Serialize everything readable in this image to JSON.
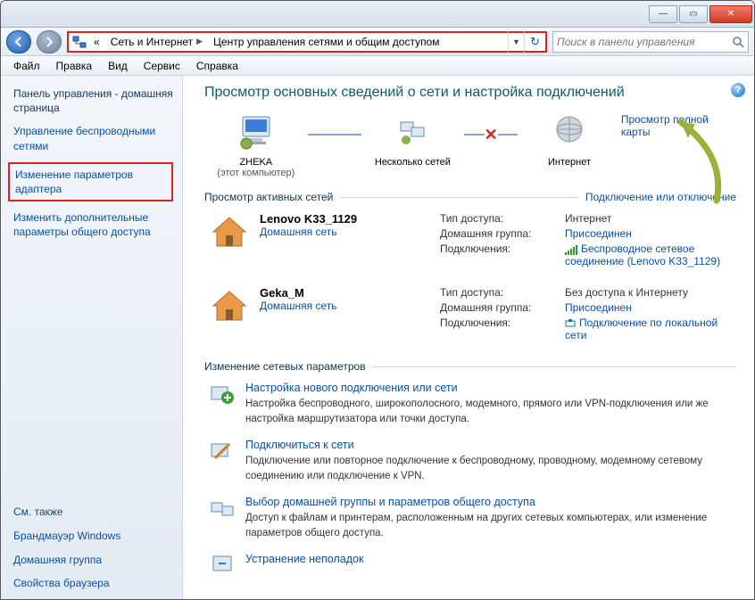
{
  "breadcrumb": {
    "root": "Сеть и Интернет",
    "current": "Центр управления сетями и общим доступом",
    "prefix": "«"
  },
  "search": {
    "placeholder": "Поиск в панели управления"
  },
  "menu": {
    "file": "Файл",
    "edit": "Правка",
    "view": "Вид",
    "tools": "Сервис",
    "help": "Справка"
  },
  "sidebar": {
    "home": "Панель управления - домашняя страница",
    "wireless": "Управление беспроводными сетями",
    "adapter": "Изменение параметров адаптера",
    "advanced": "Изменить дополнительные параметры общего доступа",
    "seealso_hdr": "См. также",
    "firewall": "Брандмауэр Windows",
    "homegroup": "Домашняя группа",
    "browser": "Свойства браузера"
  },
  "title": "Просмотр основных сведений о сети и настройка подключений",
  "map": {
    "pc": "ZHEKA",
    "pc_sub": "(этот компьютер)",
    "multi": "Несколько сетей",
    "internet": "Интернет",
    "fullmap": "Просмотр полной карты"
  },
  "active": {
    "hdr": "Просмотр активных сетей",
    "toggle": "Подключение или отключение",
    "k_access": "Тип доступа:",
    "k_hg": "Домашняя группа:",
    "k_conn": "Подключения:",
    "type_home": "Домашняя сеть",
    "nets": [
      {
        "name": "Lenovo K33_1129",
        "access": "Интернет",
        "hg": "Присоединен",
        "conn": "Беспроводное сетевое соединение (Lenovo K33_1129)",
        "wifi": true
      },
      {
        "name": "Geka_M",
        "access": "Без доступа к Интернету",
        "hg": "Присоединен",
        "conn": "Подключение по локальной сети",
        "wifi": false
      }
    ]
  },
  "change": {
    "hdr": "Изменение сетевых параметров",
    "items": [
      {
        "title": "Настройка нового подключения или сети",
        "desc": "Настройка беспроводного, широкополосного, модемного, прямого или VPN-подключения или же настройка маршрутизатора или точки доступа."
      },
      {
        "title": "Подключиться к сети",
        "desc": "Подключение или повторное подключение к беспроводному, проводному, модемному сетевому соединению или подключение к VPN."
      },
      {
        "title": "Выбор домашней группы и параметров общего доступа",
        "desc": "Доступ к файлам и принтерам, расположенным на других сетевых компьютерах, или изменение параметров общего доступа."
      },
      {
        "title": "Устранение неполадок",
        "desc": ""
      }
    ]
  }
}
